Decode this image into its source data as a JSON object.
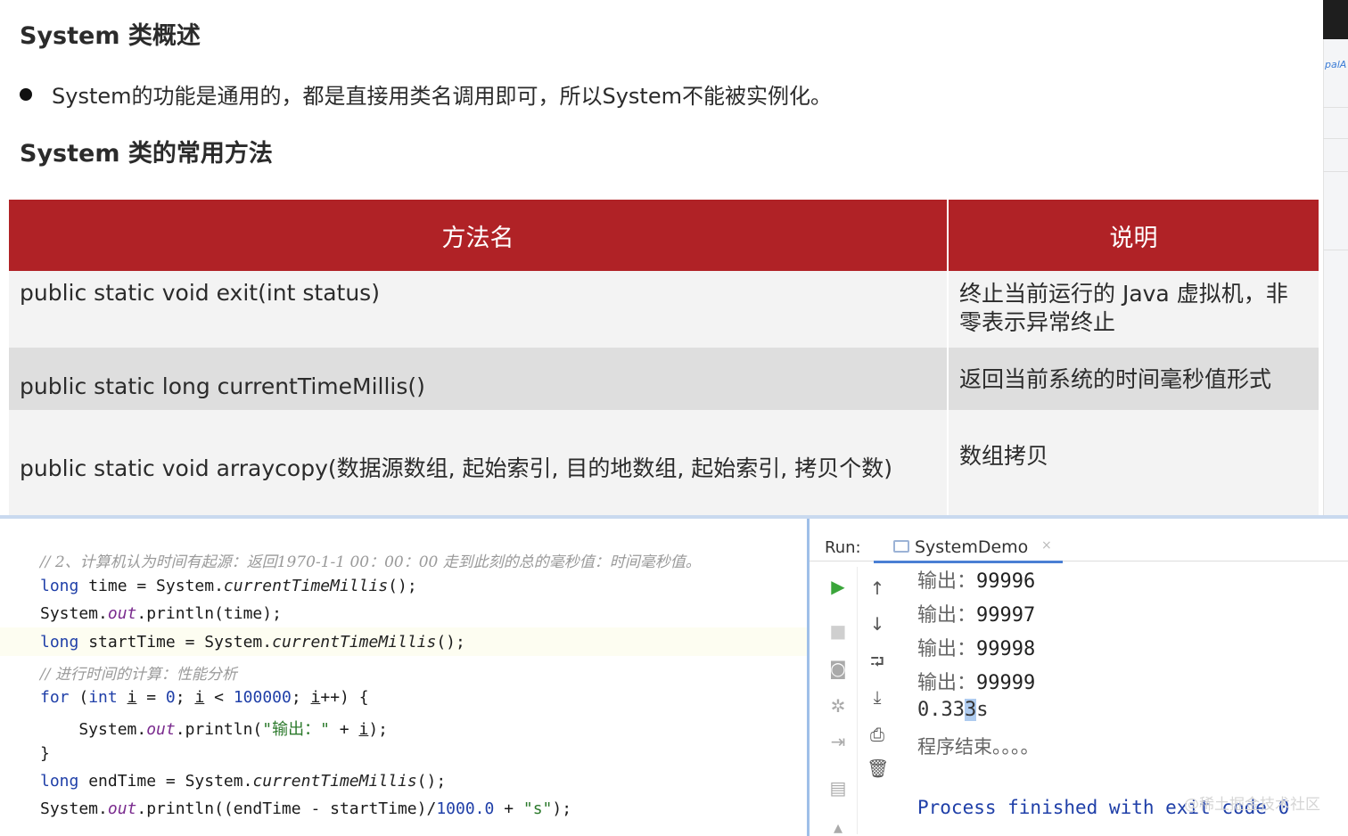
{
  "slide": {
    "title1": "System 类概述",
    "bullet": "System的功能是通用的，都是直接用类名调用即可，所以System不能被实例化。",
    "title2": "System 类的常用方法",
    "table": {
      "headers": [
        "方法名",
        "说明"
      ],
      "rows": [
        {
          "method": "public static void exit(int status)",
          "desc": "终止当前运行的 Java 虚拟机，非零表示异常终止"
        },
        {
          "method": "public static long currentTimeMillis()",
          "desc": "返回当前系统的时间毫秒值形式"
        },
        {
          "method": "public static void arraycopy(数据源数组, 起始索引, 目的地数组, 起始索引, 拷贝个数)",
          "desc": "数组拷贝"
        }
      ]
    },
    "header_color": "#b02226"
  },
  "edge": {
    "text": "palA"
  },
  "editor": {
    "comment1": "// 2、计算机认为时间有起源：返回1970-1-1 00：00：00 走到此刻的总的毫秒值：时间毫秒值。",
    "comment2": "// 进行时间的计算：性能分析",
    "line_time": {
      "kw": "long",
      "var": " time = System.",
      "fn": "currentTimeMillis",
      "end": "();"
    },
    "line_print_time": {
      "a": "System.",
      "fld": "out",
      "b": ".println(time);"
    },
    "line_start": {
      "kw": "long",
      "var": " startTime = System.",
      "fn": "currentTimeMillis",
      "end": "();"
    },
    "line_for": {
      "kw": "for",
      "a": " (",
      "kw2": "int",
      "b": " ",
      "i1": "i",
      "c": " = ",
      "n0": "0",
      "d": "; ",
      "i2": "i",
      "e": " < ",
      "n1": "100000",
      "f": "; ",
      "i3": "i",
      "g": "++) {"
    },
    "line_print_i": {
      "a": "    System.",
      "fld": "out",
      "b": ".println(",
      "str": "\"输出：\"",
      "c": " + ",
      "i": "i",
      "d": ");"
    },
    "line_close": "}",
    "line_end": {
      "kw": "long",
      "var": " endTime = System.",
      "fn": "currentTimeMillis",
      "end": "();"
    },
    "line_print_result": {
      "a": "System.",
      "fld": "out",
      "b": ".println((endTime - startTime)/",
      "num": "1000.0",
      "c": " + ",
      "str": "\"s\"",
      "d": ");"
    }
  },
  "run": {
    "label": "Run:",
    "tab": "SystemDemo",
    "tab_close": "×",
    "output_prefix": "输出：",
    "outputs": [
      "99996",
      "99997",
      "99998",
      "99999"
    ],
    "time_pre": "0.33",
    "time_sel": "3",
    "time_post": "s",
    "end_message": "程序结束。。。。",
    "process_message": "Process finished with exit code 0",
    "watermark": "@稀土掘金技术社区"
  },
  "icons": [
    "run-icon",
    "stop-icon",
    "camera-icon",
    "bug-icon",
    "login-icon",
    "layout-icon",
    "pin-icon",
    "arrow-up-icon",
    "arrow-down-icon",
    "soft-wrap-icon",
    "scroll-end-icon",
    "print-icon",
    "trash-icon"
  ]
}
